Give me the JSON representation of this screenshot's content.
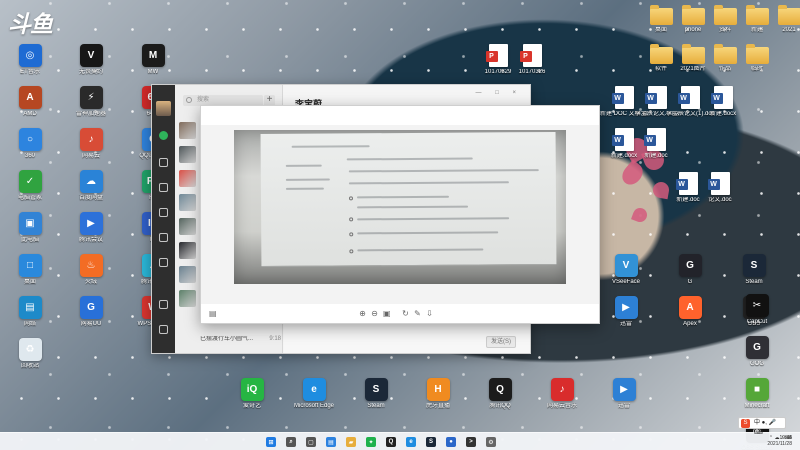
{
  "watermark": "斗鱼",
  "desktop_icons": {
    "left_col1": [
      {
        "label": "ET音乐",
        "color": "#1e6bd3",
        "symbol": "◎"
      },
      {
        "label": "AMD",
        "color": "#b64722",
        "symbol": "A"
      },
      {
        "label": "360",
        "color": "#2d84df",
        "symbol": "○"
      },
      {
        "label": "电脑管家",
        "color": "#30a340",
        "symbol": "✓"
      },
      {
        "label": "此电脑",
        "color": "#3283d5",
        "symbol": "▣"
      },
      {
        "label": "桌面",
        "color": "#2a89dc",
        "symbol": "□"
      },
      {
        "label": "网络",
        "color": "#1d8ac9",
        "symbol": "▤"
      },
      {
        "label": "回收站",
        "color": "#dfe8ee",
        "symbol": "♻"
      }
    ],
    "left_col2": [
      {
        "label": "无畏契约",
        "color": "#171717",
        "symbol": "V"
      },
      {
        "label": "雷神加速器",
        "color": "#2a2a2a",
        "symbol": "⚡"
      },
      {
        "label": "网易云",
        "color": "#d84c36",
        "symbol": "♪"
      },
      {
        "label": "百度网盘",
        "color": "#2a83d7",
        "symbol": "☁"
      },
      {
        "label": "腾讯会议",
        "color": "#2d71d9",
        "symbol": "▶"
      },
      {
        "label": "火绒",
        "color": "#f36c24",
        "symbol": "♨"
      },
      {
        "label": "网易UU",
        "color": "#2870d8",
        "symbol": "G"
      }
    ],
    "left_col3": [
      {
        "label": "MW",
        "color": "#1b1b1b",
        "symbol": "M"
      },
      {
        "label": "64位",
        "color": "#d02929",
        "symbol": "64"
      },
      {
        "label": "QQ浏览器",
        "color": "#2e81da",
        "symbol": "Q"
      },
      {
        "label": "FB",
        "color": "#20a067",
        "symbol": "Fb"
      },
      {
        "label": "IU",
        "color": "#315fc7",
        "symbol": "IU"
      },
      {
        "label": "腾讯会议",
        "color": "#2ab6d7",
        "symbol": "▲"
      },
      {
        "label": "WPS Office",
        "color": "#d8352f",
        "symbol": "W"
      }
    ],
    "bottom_row": [
      {
        "label": "爱奇艺",
        "color": "#26b543",
        "symbol": "iQ"
      },
      {
        "label": "Microsoft Edge",
        "color": "#1f8de0",
        "symbol": "e"
      },
      {
        "label": "Steam",
        "color": "#1b2838",
        "symbol": "S"
      },
      {
        "label": "虎牙直播",
        "color": "#f08b20",
        "symbol": "H"
      },
      {
        "label": "腾讯QQ",
        "color": "#1c1c1c",
        "symbol": "Q"
      },
      {
        "label": "网易云音乐",
        "color": "#d92c2c",
        "symbol": "♪"
      },
      {
        "label": "迅雷",
        "color": "#2d80d5",
        "symbol": "▶"
      }
    ],
    "right_top_folders": [
      {
        "label": "桌面",
        "kind": "folder"
      },
      {
        "label": "phone",
        "kind": "folder"
      },
      {
        "label": "资料",
        "kind": "folder"
      },
      {
        "label": "新建",
        "kind": "folder"
      },
      {
        "label": "2021",
        "kind": "folder"
      }
    ],
    "right_second_row": [
      {
        "label": "软件",
        "kind": "folder"
      },
      {
        "label": "2021图片",
        "kind": "folder"
      },
      {
        "label": "作品",
        "kind": "folder"
      },
      {
        "label": "临时",
        "kind": "folder"
      }
    ],
    "pdfs": [
      {
        "label": "10170329",
        "kind": "pdf"
      },
      {
        "label": "10170326",
        "kind": "pdf"
      }
    ],
    "docs_row1": [
      {
        "label": "新建 DOC 文档.doc",
        "kind": "doc",
        "badge": "W"
      },
      {
        "label": "李宝辰论文.docx",
        "kind": "doc",
        "badge": "W"
      },
      {
        "label": "李宝辰论文(1).docx",
        "kind": "doc",
        "badge": "W"
      },
      {
        "label": "新建.docx",
        "kind": "doc",
        "badge": "W"
      }
    ],
    "docs_row2": [
      {
        "label": "新建.docx",
        "kind": "doc",
        "badge": "W"
      },
      {
        "label": "新建.doc",
        "kind": "doc",
        "badge": "W"
      }
    ],
    "docs_row3": [
      {
        "label": "新建.doc",
        "kind": "doc",
        "badge": "W"
      },
      {
        "label": "论文.doc",
        "kind": "doc",
        "badge": "W"
      }
    ],
    "right_lower": [
      {
        "label": "VSeeFace",
        "color": "#3292d6",
        "symbol": "V"
      },
      {
        "label": "G",
        "color": "#22232a",
        "symbol": "G"
      },
      {
        "label": "Steam",
        "color": "#1b2838",
        "symbol": "S"
      },
      {
        "label": "迅雷",
        "color": "#2d80d5",
        "symbol": "▶"
      },
      {
        "label": "Apex",
        "color": "#ff622c",
        "symbol": "A"
      },
      {
        "label": "OBS",
        "color": "#202020",
        "symbol": "●"
      },
      {
        "label": "CapCut",
        "color": "#111111",
        "symbol": "✂"
      },
      {
        "label": "GOG",
        "color": "#2f2f35",
        "symbol": "G"
      },
      {
        "label": "Minecraft",
        "color": "#55a739",
        "symbol": "■"
      },
      {
        "label": "OBS Studio",
        "color": "#111111",
        "symbol": "◉"
      }
    ]
  },
  "chat_window": {
    "search_placeholder": "搜索",
    "add_symbol": "+",
    "title": "李宝蔚",
    "controls": "— □ ×",
    "last_message": "9:18",
    "snippet": "已摆渡行车小圆气...",
    "send_label": "发送(S)",
    "avatars": [
      "#7f6a5a",
      "#4d5558",
      "#d94f46",
      "#6e8796",
      "#53635d",
      "#25262b",
      "#687f8e",
      "#5b7f68"
    ]
  },
  "image_viewer": {
    "toolbar": [
      {
        "name": "zoom-in-tool",
        "symbol": "⊕"
      },
      {
        "name": "zoom-out-tool",
        "symbol": "⊖"
      },
      {
        "name": "actual-size-tool",
        "symbol": "▣"
      },
      {
        "name": "rotate-tool",
        "symbol": "↻"
      },
      {
        "name": "edit-tool",
        "symbol": "✎"
      },
      {
        "name": "download-tool",
        "symbol": "⇩"
      }
    ],
    "left_tool": "▤"
  },
  "taskbar": {
    "apps": [
      {
        "name": "start",
        "color": "#1f7be2",
        "symbol": "⊞"
      },
      {
        "name": "search",
        "color": "#555555",
        "symbol": "⌕"
      },
      {
        "name": "task-view",
        "color": "#555555",
        "symbol": "▢"
      },
      {
        "name": "widgets",
        "color": "#2d82df",
        "symbol": "▤"
      },
      {
        "name": "explorer",
        "color": "#e7ad3b",
        "symbol": "▰"
      },
      {
        "name": "wechat",
        "color": "#20b14c",
        "symbol": "✦"
      },
      {
        "name": "qq",
        "color": "#222222",
        "symbol": "Q"
      },
      {
        "name": "edge",
        "color": "#1f8de0",
        "symbol": "e"
      },
      {
        "name": "steam",
        "color": "#1b2838",
        "symbol": "S"
      },
      {
        "name": "browser",
        "color": "#2b67c9",
        "symbol": "●"
      },
      {
        "name": "terminal",
        "color": "#333333",
        "symbol": ">"
      },
      {
        "name": "settings",
        "color": "#666666",
        "symbol": "⚙"
      }
    ],
    "tray_icons": "⌃ ☁ ♪ ⌨",
    "time": "19:46",
    "date": "2021/11/28"
  },
  "ime": {
    "logo": "S",
    "text": "中 ●, 🎤 ⌨"
  }
}
